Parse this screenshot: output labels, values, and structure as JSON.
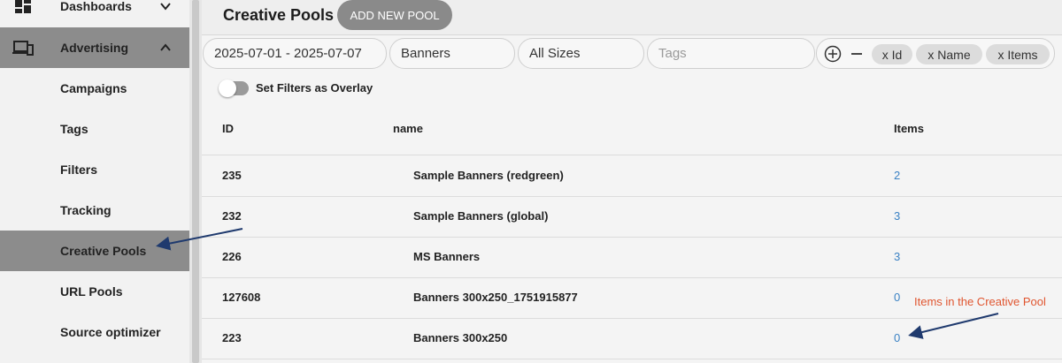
{
  "sidebar": {
    "items": [
      {
        "label": "Dashboards",
        "icon": "dashboard-icon",
        "chevron": "chevron-down-icon"
      },
      {
        "label": "Advertising",
        "icon": "devices-icon",
        "chevron": "chevron-up-icon"
      },
      {
        "label": "Campaigns"
      },
      {
        "label": "Tags"
      },
      {
        "label": "Filters"
      },
      {
        "label": "Tracking"
      },
      {
        "label": "Creative Pools"
      },
      {
        "label": "URL Pools"
      },
      {
        "label": "Source optimizer"
      }
    ]
  },
  "header": {
    "title": "Creative Pools",
    "add_button": "ADD NEW POOL"
  },
  "filters": {
    "date_range": "2025-07-01 - 2025-07-07",
    "type": "Banners",
    "size": "All Sizes",
    "tags_placeholder": "Tags"
  },
  "columns": {
    "chips": [
      "x Id",
      "x Name",
      "x Items"
    ]
  },
  "overlay_toggle": {
    "label": "Set Filters as Overlay"
  },
  "table": {
    "headers": [
      "ID",
      "name",
      "Items"
    ],
    "rows": [
      {
        "id": "235",
        "name": "Sample Banners (redgreen)",
        "items": "2"
      },
      {
        "id": "232",
        "name": "Sample Banners (global)",
        "items": "3"
      },
      {
        "id": "226",
        "name": "MS Banners",
        "items": "3"
      },
      {
        "id": "127608",
        "name": "Banners 300x250_1751915877",
        "items": "0"
      },
      {
        "id": "223",
        "name": "Banners 300x250",
        "items": "0"
      }
    ]
  },
  "annotation": {
    "text": "Items in the Creative Pool",
    "color": "#e0552f",
    "arrow_color": "#1f3a6e"
  },
  "colors": {
    "active_item": "#8c8c8c",
    "link": "#3b82c4"
  }
}
